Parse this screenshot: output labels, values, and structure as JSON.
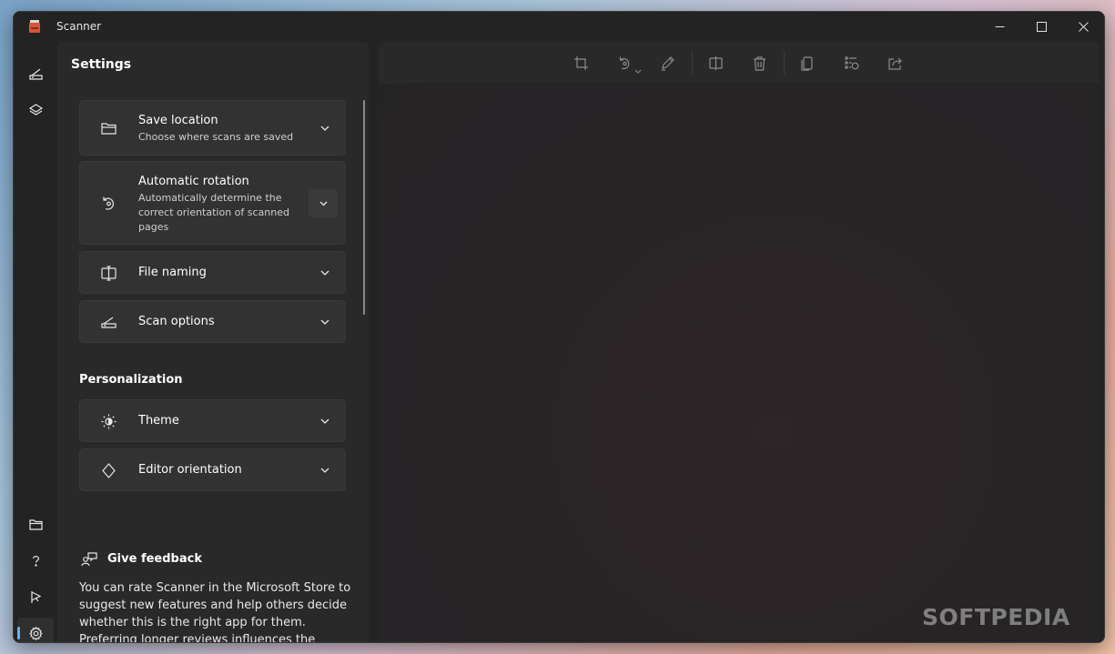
{
  "app": {
    "title": "Scanner"
  },
  "settings": {
    "title": "Settings",
    "cards": [
      {
        "title": "Save location",
        "desc": "Choose where scans are saved"
      },
      {
        "title": "Automatic rotation",
        "desc": "Automatically determine the correct orientation of scanned pages"
      },
      {
        "title": "File naming"
      },
      {
        "title": "Scan options"
      }
    ],
    "personalization": {
      "header": "Personalization",
      "cards": [
        {
          "title": "Theme"
        },
        {
          "title": "Editor orientation"
        }
      ]
    },
    "feedback": {
      "title": "Give feedback",
      "text": "You can rate Scanner in the Microsoft Store to suggest new features and help others decide whether this is the right app for them. Preferring longer reviews influences the further"
    }
  },
  "watermark": "SOFTPEDIA",
  "colors": {
    "accent": "#5fb2f2",
    "window_bg": "#232323",
    "panel_bg": "#2a2929",
    "card_bg": "#333232"
  }
}
